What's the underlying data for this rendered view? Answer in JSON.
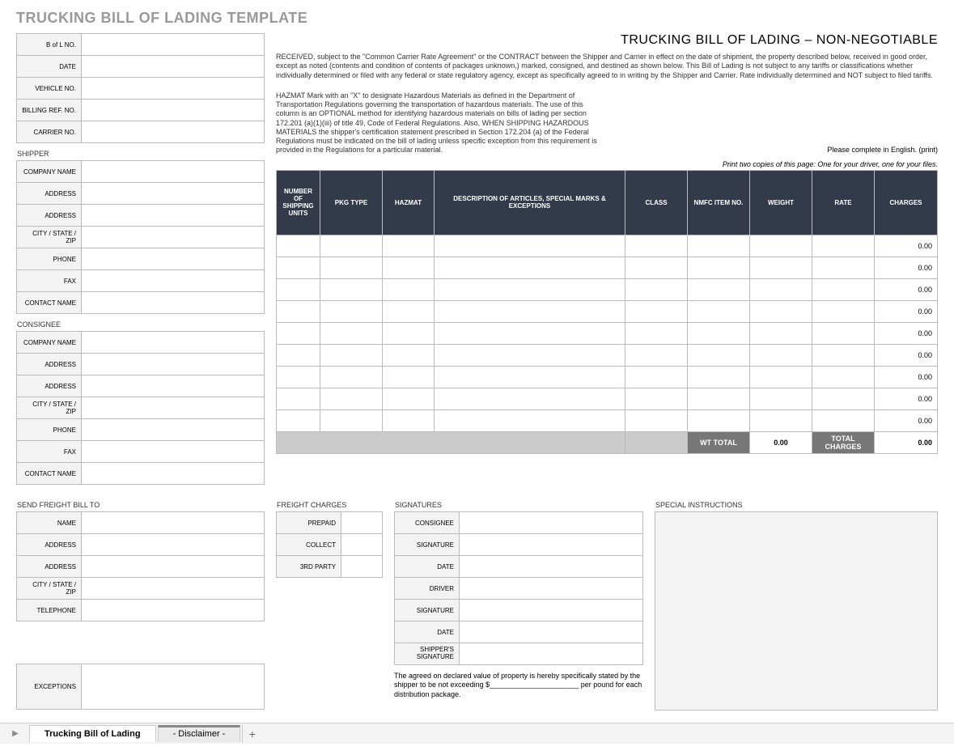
{
  "title": "TRUCKING BILL OF LADING TEMPLATE",
  "subtitle": "TRUCKING BILL OF LADING – NON-NEGOTIABLE",
  "hdr": {
    "bol": "B of L NO.",
    "date": "DATE",
    "vehicle": "VEHICLE NO.",
    "billing": "BILLING REF. NO.",
    "carrier": "CARRIER NO."
  },
  "fine_received": "RECEIVED, subject to the \"Common Carrier Rate Agreement\" or the CONTRACT between the Shipper and Carrier in effect on the date of shipment, the property described below, received in good order, except as noted (contents and condition of contents of packages unknown,) marked, consigned, and destined as shown below.  This Bill of Lading is not subject to any tariffs or classifications whether individually determined or filed with any federal or state regulatory agency, except as specifically agreed to in writing by the Shipper and Carrier.  Rate individually determined and NOT subject to filed tariffs.",
  "fine_hazmat": "HAZMAT Mark with an \"X\" to designate Hazardous Materials as defined in the Department of Transportation Regulations governing the transportation of hazardous materials.   The use of this column is an OPTIONAL method for identifying hazardous materials on bills of lading per section 172.201 (a)(1)(iii)  of title 49, Code of Federal Regulations.  Also, WHEN SHIPPING HAZARDOUS MATERIALS the shipper's certification statement prescribed in Section 172.204 (a) of the Federal Regulations must be indicated on the bill of lading unless specific exception from this requirement is provided in the Regulations for a particular material.",
  "please_complete": "Please complete in English. (print)",
  "print_two": "Print two copies of this page: One for your driver, one for your files.",
  "sections": {
    "shipper": "SHIPPER",
    "consignee": "CONSIGNEE",
    "sendto": "SEND FREIGHT BILL TO",
    "freight": "FREIGHT CHARGES",
    "signatures": "SIGNATURES",
    "special": "SPECIAL INSTRUCTIONS"
  },
  "kv": {
    "company": "COMPANY NAME",
    "address": "ADDRESS",
    "city": "CITY / STATE / ZIP",
    "phone": "PHONE",
    "fax": "FAX",
    "contact": "CONTACT NAME",
    "name": "NAME",
    "telephone": "TELEPHONE",
    "exceptions": "EXCEPTIONS"
  },
  "freight": {
    "prepaid": "PREPAID",
    "collect": "COLLECT",
    "third": "3RD PARTY"
  },
  "sig": {
    "consignee": "CONSIGNEE",
    "signature": "SIGNATURE",
    "date": "DATE",
    "driver": "DRIVER",
    "shipper": "SHIPPER'S SIGNATURE"
  },
  "declared": "The agreed on declared value of property is hereby specifically stated by the shipper to be not exceeding $______________________ per pound for each distribution package.",
  "table": {
    "headers": {
      "units": "NUMBER OF SHIPPING UNITS",
      "pkg": "PKG TYPE",
      "hazmat": "HAZMAT",
      "desc": "DESCRIPTION OF ARTICLES, SPECIAL MARKS & EXCEPTIONS",
      "class": "CLASS",
      "nmfc": "NMFC ITEM NO.",
      "weight": "WEIGHT",
      "rate": "RATE",
      "charges": "CHARGES"
    },
    "rows": [
      {
        "charges": "0.00"
      },
      {
        "charges": "0.00"
      },
      {
        "charges": "0.00"
      },
      {
        "charges": "0.00"
      },
      {
        "charges": "0.00"
      },
      {
        "charges": "0.00"
      },
      {
        "charges": "0.00"
      },
      {
        "charges": "0.00"
      },
      {
        "charges": "0.00"
      }
    ],
    "foot": {
      "wt_label": "WT TOTAL",
      "wt_val": "0.00",
      "chg_label": "TOTAL CHARGES",
      "chg_val": "0.00"
    }
  },
  "tabs": {
    "active": "Trucking Bill of Lading",
    "disclaimer": "- Disclaimer -"
  }
}
